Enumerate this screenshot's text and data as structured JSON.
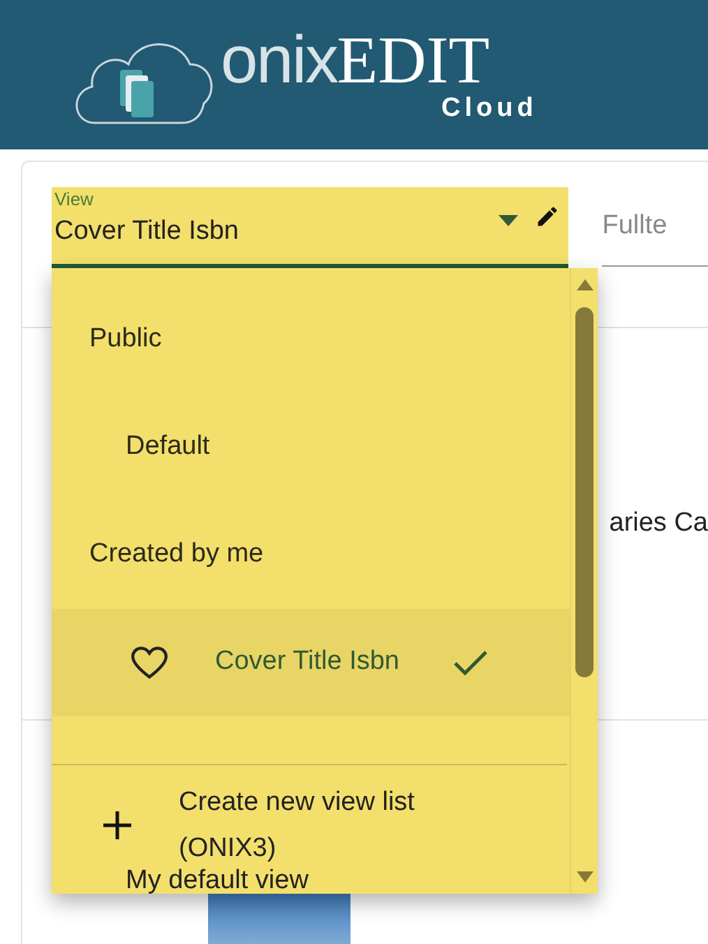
{
  "header": {
    "logo": {
      "light": "onix",
      "bold": "EDIT",
      "sub": "Cloud"
    }
  },
  "view_select": {
    "label": "View",
    "value": "Cover Title Isbn",
    "expanded": true
  },
  "fulltext_field": {
    "placeholder": "Fullte"
  },
  "background_row": {
    "text": "aries Ca"
  },
  "dropdown": {
    "items": [
      {
        "kind": "group",
        "label": "Public"
      },
      {
        "kind": "option",
        "label": "Default",
        "selected": false
      },
      {
        "kind": "group",
        "label": "Created by me"
      },
      {
        "kind": "option",
        "label": "Cover Title Isbn",
        "selected": true
      }
    ],
    "peek_item": "My default view",
    "footer_action": {
      "label": "Create new view list (ONIX3)"
    }
  }
}
